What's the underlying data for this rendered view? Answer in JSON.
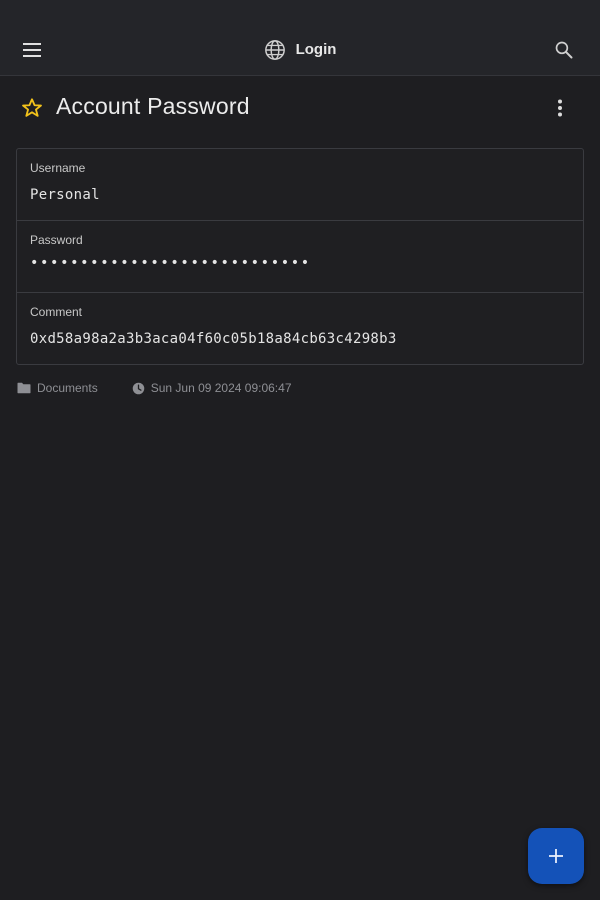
{
  "app_bar": {
    "title": "Login",
    "icons": {
      "menu": "menu-icon",
      "globe": "globe-icon",
      "search": "search-icon"
    }
  },
  "header": {
    "title": "Account Password",
    "favorite_icon": "star-outline-icon",
    "favorite_color": "#f2c21b",
    "more_icon": "more-vertical-icon"
  },
  "fields": [
    {
      "label": "Username",
      "value": "Personal"
    },
    {
      "label": "Password",
      "value": "••••••••••••••••••••••••••••"
    },
    {
      "label": "Comment",
      "value": "0xd58a98a2a3b3aca04f60c05b18a84cb63c4298b3"
    }
  ],
  "meta": {
    "folder": "Documents",
    "folder_icon": "folder-icon",
    "timestamp": "Sun Jun 09 2024 09:06:47",
    "clock_icon": "clock-icon"
  },
  "fab": {
    "icon": "plus-icon",
    "color": "#1452b8"
  }
}
